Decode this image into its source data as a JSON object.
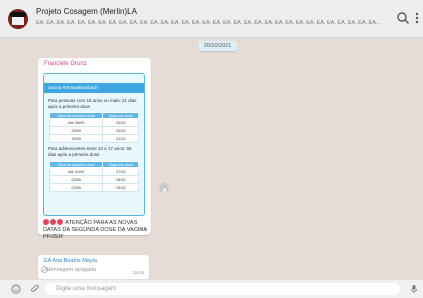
{
  "header": {
    "title": "Projeto Cosagem (Merlin)LA",
    "subtitle": "ÉA, ÉA, ÉA, ÉA, ÉA, ÉA, ÉA, ÉA, ÉA, ÉA, ÉA, ÉA, ÉA, ÉA, ÉA, ÉA, ÉA, ÉA, ÉA, ÉA, ÉA, ÉA, ÉA, ÉA, ÉA, ÉA, ÉA, ÉA, ÉA, ÉA, ÉA, ÉA, ÉA, ÉA, ÉA, ÉA, ÉA, ÉA, ÉA, ÉA, ÉA, ÉA, Evonton, Frandes, Medição, Mara, Kely, Sol..."
  },
  "date_chip": "20/10/2021",
  "message1": {
    "sender": "Franciele Grunz",
    "card_title": "Vacina #ViravaBlumbach",
    "group1_text": "Para pessoas com 18 anos ou mais: 21 dias após a primeira dose",
    "table1": {
      "headers": [
        "Data da primeira dose",
        "Segunda dose"
      ],
      "rows": [
        [
          "Até 28/09",
          "20/10"
        ],
        [
          "29/09",
          "20/10"
        ],
        [
          "30/09",
          "21/10"
        ]
      ]
    },
    "group2_text": "Para adolescentes entre 12 e 17 anos: 56 dias após a primeira dose",
    "table2": {
      "headers": [
        "Data da primeira dose",
        "Segunda dose"
      ],
      "rows": [
        [
          "Até 01/09",
          "27/10"
        ],
        [
          "02/09",
          "28/10"
        ],
        [
          "03/09",
          "29/10"
        ]
      ]
    },
    "caption": "ATENÇÃO PARA AS NOVAS DATAS DA SEGUNDA DOSE DA VACINA PFIZER",
    "time": "15:12"
  },
  "message2": {
    "sender": "EA Ana Beatriz Mayla",
    "deleted_text": "Mensagem apagada",
    "time": "15:28"
  },
  "footer": {
    "placeholder": "Digite uma mensagem"
  },
  "colors": {
    "accent": "#3ea6e0",
    "sender_pink": "#d6407a",
    "sender_blue": "#2f87c9"
  },
  "icons": [
    "search-icon",
    "menu-icon",
    "share-icon",
    "chevron-down-icon",
    "emoji-icon",
    "attach-icon",
    "microphone-icon",
    "deleted-icon"
  ]
}
